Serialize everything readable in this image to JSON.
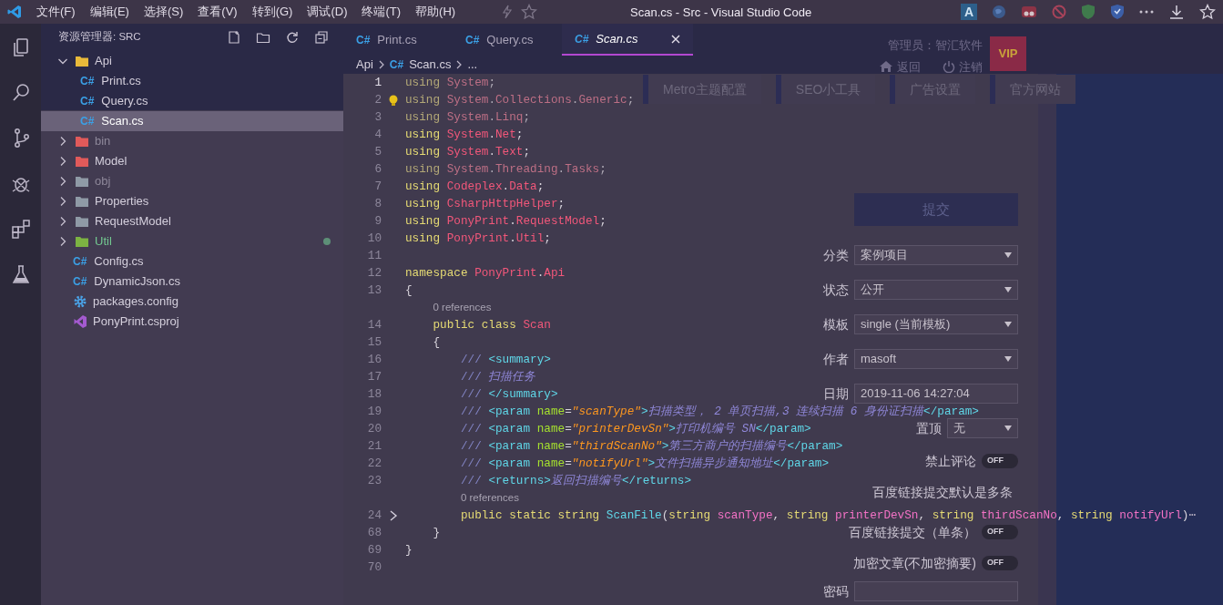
{
  "window": {
    "title": "Scan.cs - Src - Visual Studio Code"
  },
  "menu": [
    "文件(F)",
    "编辑(E)",
    "选择(S)",
    "查看(V)",
    "转到(G)",
    "调试(D)",
    "终端(T)",
    "帮助(H)"
  ],
  "browser_badge": "A",
  "sidebar": {
    "title": "资源管理器: SRC",
    "tree": [
      {
        "label": "Api",
        "kind": "folder",
        "color": "#e8b93a",
        "expanded": true,
        "selected": false,
        "ignored": false,
        "modified": false,
        "children": [
          {
            "label": "Print.cs",
            "kind": "csharp",
            "icon_label": "C#",
            "selected": false,
            "ignored": false,
            "modified": false
          },
          {
            "label": "Query.cs",
            "kind": "csharp",
            "icon_label": "C#",
            "selected": false,
            "ignored": false,
            "modified": false
          },
          {
            "label": "Scan.cs",
            "kind": "csharp",
            "icon_label": "C#",
            "selected": true,
            "ignored": false,
            "modified": false
          }
        ]
      },
      {
        "label": "bin",
        "kind": "folder",
        "color": "#e05a5a",
        "expanded": false,
        "selected": false,
        "ignored": true,
        "modified": false
      },
      {
        "label": "Model",
        "kind": "folder",
        "color": "#e05a5a",
        "expanded": false,
        "selected": false,
        "ignored": false,
        "modified": false
      },
      {
        "label": "obj",
        "kind": "folder",
        "color": "#8f9aa6",
        "expanded": false,
        "selected": false,
        "ignored": true,
        "modified": false
      },
      {
        "label": "Properties",
        "kind": "folder",
        "color": "#8f9aa6",
        "expanded": false,
        "selected": false,
        "ignored": false,
        "modified": false
      },
      {
        "label": "RequestModel",
        "kind": "folder",
        "color": "#8f9aa6",
        "expanded": false,
        "selected": false,
        "ignored": false,
        "modified": false
      },
      {
        "label": "Util",
        "kind": "folder",
        "color": "#7cb342",
        "expanded": false,
        "selected": false,
        "ignored": false,
        "modified": true
      },
      {
        "label": "Config.cs",
        "kind": "csharp",
        "icon_label": "C#",
        "selected": false,
        "ignored": false,
        "modified": false
      },
      {
        "label": "DynamicJson.cs",
        "kind": "csharp",
        "icon_label": "C#",
        "selected": false,
        "ignored": false,
        "modified": false
      },
      {
        "label": "packages.config",
        "kind": "config",
        "selected": false,
        "ignored": false,
        "modified": false
      },
      {
        "label": "PonyPrint.csproj",
        "kind": "csproj",
        "selected": false,
        "ignored": false,
        "modified": false
      }
    ]
  },
  "tabs": [
    {
      "label": "Print.cs",
      "icon_label": "C#",
      "selected": false
    },
    {
      "label": "Query.cs",
      "icon_label": "C#",
      "selected": false
    },
    {
      "label": "Scan.cs",
      "icon_label": "C#",
      "selected": true
    }
  ],
  "breadcrumb": [
    {
      "text": "Api"
    },
    {
      "text": "Scan.cs",
      "icon_label": "C#"
    },
    {
      "text": "..."
    }
  ],
  "code_lines": [
    {
      "kind": "code",
      "number": "1",
      "faded": true,
      "folded": false,
      "lightbulb": false,
      "tokens": [
        {
          "kind": "kw",
          "text": "using"
        },
        {
          "kind": "ns",
          "text": " System"
        },
        {
          "kind": "p",
          "text": ";"
        }
      ]
    },
    {
      "kind": "code",
      "number": "2",
      "faded": true,
      "folded": false,
      "lightbulb": true,
      "tokens": [
        {
          "kind": "kw",
          "text": "using"
        },
        {
          "kind": "ns",
          "text": " System"
        },
        {
          "kind": "p",
          "text": "."
        },
        {
          "kind": "ns",
          "text": "Collections"
        },
        {
          "kind": "p",
          "text": "."
        },
        {
          "kind": "ns",
          "text": "Generic"
        },
        {
          "kind": "p",
          "text": ";"
        }
      ]
    },
    {
      "kind": "code",
      "number": "3",
      "faded": true,
      "folded": false,
      "lightbulb": false,
      "tokens": [
        {
          "kind": "kw",
          "text": "using"
        },
        {
          "kind": "ns",
          "text": " System"
        },
        {
          "kind": "p",
          "text": "."
        },
        {
          "kind": "ns",
          "text": "Linq"
        },
        {
          "kind": "p",
          "text": ";"
        }
      ]
    },
    {
      "kind": "code",
      "number": "4",
      "faded": false,
      "folded": false,
      "lightbulb": false,
      "tokens": [
        {
          "kind": "kw",
          "text": "using"
        },
        {
          "kind": "ns",
          "text": " System"
        },
        {
          "kind": "p",
          "text": "."
        },
        {
          "kind": "ns",
          "text": "Net"
        },
        {
          "kind": "p",
          "text": ";"
        }
      ]
    },
    {
      "kind": "code",
      "number": "5",
      "faded": false,
      "folded": false,
      "lightbulb": false,
      "tokens": [
        {
          "kind": "kw",
          "text": "using"
        },
        {
          "kind": "ns",
          "text": " System"
        },
        {
          "kind": "p",
          "text": "."
        },
        {
          "kind": "ns",
          "text": "Text"
        },
        {
          "kind": "p",
          "text": ";"
        }
      ]
    },
    {
      "kind": "code",
      "number": "6",
      "faded": true,
      "folded": false,
      "lightbulb": false,
      "tokens": [
        {
          "kind": "kw",
          "text": "using"
        },
        {
          "kind": "ns",
          "text": " System"
        },
        {
          "kind": "p",
          "text": "."
        },
        {
          "kind": "ns",
          "text": "Threading"
        },
        {
          "kind": "p",
          "text": "."
        },
        {
          "kind": "ns",
          "text": "Tasks"
        },
        {
          "kind": "p",
          "text": ";"
        }
      ]
    },
    {
      "kind": "code",
      "number": "7",
      "faded": false,
      "folded": false,
      "lightbulb": false,
      "tokens": [
        {
          "kind": "kw",
          "text": "using"
        },
        {
          "kind": "ns",
          "text": " Codeplex"
        },
        {
          "kind": "p",
          "text": "."
        },
        {
          "kind": "ns",
          "text": "Data"
        },
        {
          "kind": "p",
          "text": ";"
        }
      ]
    },
    {
      "kind": "code",
      "number": "8",
      "faded": false,
      "folded": false,
      "lightbulb": false,
      "tokens": [
        {
          "kind": "kw",
          "text": "using"
        },
        {
          "kind": "ns",
          "text": " CsharpHttpHelper"
        },
        {
          "kind": "p",
          "text": ";"
        }
      ]
    },
    {
      "kind": "code",
      "number": "9",
      "faded": false,
      "folded": false,
      "lightbulb": false,
      "tokens": [
        {
          "kind": "kw",
          "text": "using"
        },
        {
          "kind": "ns",
          "text": " PonyPrint"
        },
        {
          "kind": "p",
          "text": "."
        },
        {
          "kind": "ns",
          "text": "RequestModel"
        },
        {
          "kind": "p",
          "text": ";"
        }
      ]
    },
    {
      "kind": "code",
      "number": "10",
      "faded": false,
      "folded": false,
      "lightbulb": false,
      "tokens": [
        {
          "kind": "kw",
          "text": "using"
        },
        {
          "kind": "ns",
          "text": " PonyPrint"
        },
        {
          "kind": "p",
          "text": "."
        },
        {
          "kind": "ns",
          "text": "Util"
        },
        {
          "kind": "p",
          "text": ";"
        }
      ]
    },
    {
      "kind": "code",
      "number": "11",
      "folded": false,
      "lightbulb": false
    },
    {
      "kind": "code",
      "number": "12",
      "faded": false,
      "folded": false,
      "lightbulb": false,
      "tokens": [
        {
          "kind": "kw",
          "text": "namespace"
        },
        {
          "kind": "ns",
          "text": " PonyPrint"
        },
        {
          "kind": "p",
          "text": "."
        },
        {
          "kind": "ns",
          "text": "Api"
        }
      ]
    },
    {
      "kind": "code",
      "number": "13",
      "faded": false,
      "folded": false,
      "lightbulb": false,
      "tokens": [
        {
          "kind": "p",
          "text": "{"
        }
      ]
    },
    {
      "kind": "codelens",
      "text": "    0 references"
    },
    {
      "kind": "code",
      "number": "14",
      "faded": false,
      "folded": false,
      "lightbulb": false,
      "tokens": [
        {
          "kind": "kw",
          "text": "    public class"
        },
        {
          "kind": "ns",
          "text": " Scan"
        }
      ]
    },
    {
      "kind": "code",
      "number": "15",
      "faded": false,
      "folded": false,
      "lightbulb": false,
      "tokens": [
        {
          "kind": "p",
          "text": "    {"
        }
      ]
    },
    {
      "kind": "code",
      "number": "16",
      "faded": false,
      "folded": false,
      "lightbulb": false,
      "tokens": [
        {
          "kind": "c",
          "text": "        ///"
        },
        {
          "kind": "tag",
          "text": " <summary>"
        }
      ]
    },
    {
      "kind": "code",
      "number": "17",
      "faded": false,
      "folded": false,
      "lightbulb": false,
      "tokens": [
        {
          "kind": "c",
          "text": "        ///"
        },
        {
          "kind": "doc",
          "text": " 扫描任务"
        }
      ]
    },
    {
      "kind": "code",
      "number": "18",
      "faded": false,
      "folded": false,
      "lightbulb": false,
      "tokens": [
        {
          "kind": "c",
          "text": "        ///"
        },
        {
          "kind": "tag",
          "text": " </summary>"
        }
      ]
    },
    {
      "kind": "code",
      "number": "19",
      "faded": false,
      "folded": false,
      "lightbulb": false,
      "tokens": [
        {
          "kind": "c",
          "text": "        ///"
        },
        {
          "kind": "tag",
          "text": " <param"
        },
        {
          "kind": "attr",
          "text": " name"
        },
        {
          "kind": "p",
          "text": "="
        },
        {
          "kind": "str",
          "text": "\"scanType\""
        },
        {
          "kind": "tag",
          "text": ">"
        },
        {
          "kind": "doc",
          "text": "扫描类型， 2 单页扫描,3 连续扫描 6 身份证扫描"
        },
        {
          "kind": "tag",
          "text": "</param>"
        }
      ]
    },
    {
      "kind": "code",
      "number": "20",
      "faded": false,
      "folded": false,
      "lightbulb": false,
      "tokens": [
        {
          "kind": "c",
          "text": "        ///"
        },
        {
          "kind": "tag",
          "text": " <param"
        },
        {
          "kind": "attr",
          "text": " name"
        },
        {
          "kind": "p",
          "text": "="
        },
        {
          "kind": "str",
          "text": "\"printerDevSn\""
        },
        {
          "kind": "tag",
          "text": ">"
        },
        {
          "kind": "doc",
          "text": "打印机编号 SN"
        },
        {
          "kind": "tag",
          "text": "</param>"
        }
      ]
    },
    {
      "kind": "code",
      "number": "21",
      "faded": false,
      "folded": false,
      "lightbulb": false,
      "tokens": [
        {
          "kind": "c",
          "text": "        ///"
        },
        {
          "kind": "tag",
          "text": " <param"
        },
        {
          "kind": "attr",
          "text": " name"
        },
        {
          "kind": "p",
          "text": "="
        },
        {
          "kind": "str",
          "text": "\"thirdScanNo\""
        },
        {
          "kind": "tag",
          "text": ">"
        },
        {
          "kind": "doc",
          "text": "第三方商户的扫描编号"
        },
        {
          "kind": "tag",
          "text": "</param>"
        }
      ]
    },
    {
      "kind": "code",
      "number": "22",
      "faded": false,
      "folded": false,
      "lightbulb": false,
      "tokens": [
        {
          "kind": "c",
          "text": "        ///"
        },
        {
          "kind": "tag",
          "text": " <param"
        },
        {
          "kind": "attr",
          "text": " name"
        },
        {
          "kind": "p",
          "text": "="
        },
        {
          "kind": "str",
          "text": "\"notifyUrl\""
        },
        {
          "kind": "tag",
          "text": ">"
        },
        {
          "kind": "doc",
          "text": "文件扫描异步通知地址"
        },
        {
          "kind": "tag",
          "text": "</param>"
        }
      ]
    },
    {
      "kind": "code",
      "number": "23",
      "faded": false,
      "folded": false,
      "lightbulb": false,
      "tokens": [
        {
          "kind": "c",
          "text": "        ///"
        },
        {
          "kind": "tag",
          "text": " <returns>"
        },
        {
          "kind": "doc",
          "text": "返回扫描编号"
        },
        {
          "kind": "tag",
          "text": "</returns>"
        }
      ]
    },
    {
      "kind": "codelens",
      "text": "        0 references"
    },
    {
      "kind": "code",
      "number": "24",
      "faded": false,
      "folded": true,
      "lightbulb": false,
      "tokens": [
        {
          "kind": "kw",
          "text": "        public static string"
        },
        {
          "kind": "fn",
          "text": " ScanFile"
        },
        {
          "kind": "p",
          "text": "("
        },
        {
          "kind": "kw",
          "text": "string"
        },
        {
          "kind": "par",
          "text": " scanType"
        },
        {
          "kind": "p",
          "text": ", "
        },
        {
          "kind": "kw",
          "text": "string"
        },
        {
          "kind": "par",
          "text": " printerDevSn"
        },
        {
          "kind": "p",
          "text": ", "
        },
        {
          "kind": "kw",
          "text": "string"
        },
        {
          "kind": "par",
          "text": " thirdScanNo"
        },
        {
          "kind": "p",
          "text": ", "
        },
        {
          "kind": "kw",
          "text": "string"
        },
        {
          "kind": "par",
          "text": " notifyUrl"
        },
        {
          "kind": "p",
          "text": ")"
        },
        {
          "kind": "fold",
          "text": "⋯"
        }
      ]
    },
    {
      "kind": "code",
      "number": "68",
      "faded": false,
      "folded": false,
      "lightbulb": false,
      "tokens": [
        {
          "kind": "p",
          "text": "    }"
        }
      ]
    },
    {
      "kind": "code",
      "number": "69",
      "faded": false,
      "folded": false,
      "lightbulb": false,
      "tokens": [
        {
          "kind": "p",
          "text": "}"
        }
      ]
    },
    {
      "kind": "code",
      "number": "70",
      "folded": false,
      "lightbulb": false
    }
  ],
  "background_page": {
    "admin": "管理员：智汇软件",
    "links": [
      "返回",
      "注销"
    ],
    "vip": "VIP",
    "nav": [
      "Metro主题配置",
      "SEO小工具",
      "广告设置",
      "官方网站"
    ],
    "submit": "提交",
    "fields": [
      {
        "kind": "select",
        "label": "分类",
        "value": "案例项目"
      },
      {
        "kind": "select",
        "label": "状态",
        "value": "公开"
      },
      {
        "kind": "select",
        "label": "模板",
        "value": "single (当前模板)"
      },
      {
        "kind": "select",
        "label": "作者",
        "value": "masoft"
      },
      {
        "kind": "input",
        "label": "日期",
        "value": "2019-11-06 14:27:04"
      },
      {
        "kind": "select_small",
        "label": "置顶",
        "value": "无"
      },
      {
        "kind": "toggle",
        "label": "禁止评论",
        "on": false,
        "text": "OFF"
      },
      {
        "kind": "note",
        "label": "百度链接提交默认是多条"
      },
      {
        "kind": "toggle",
        "label": "百度链接提交（单条）",
        "on": false,
        "text": "OFF"
      },
      {
        "kind": "toggle",
        "label": "加密文章(不加密摘要)",
        "on": false,
        "text": "OFF"
      },
      {
        "kind": "input",
        "label": "密码"
      }
    ]
  }
}
